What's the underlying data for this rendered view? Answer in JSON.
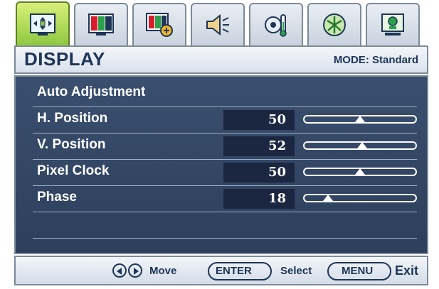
{
  "header": {
    "title": "DISPLAY",
    "mode_label": "MODE: Standard"
  },
  "tabs": [
    {
      "icon": "display-settings-icon",
      "active": true
    },
    {
      "icon": "picture-icon",
      "active": false
    },
    {
      "icon": "picture-advanced-icon",
      "active": false
    },
    {
      "icon": "audio-speaker-icon",
      "active": false
    },
    {
      "icon": "system-settings-icon",
      "active": false
    },
    {
      "icon": "eco-leaf-icon",
      "active": false
    },
    {
      "icon": "save-settings-icon",
      "active": false
    }
  ],
  "menu": {
    "auto_adjustment": "Auto Adjustment",
    "items": [
      {
        "label": "H. Position",
        "value": "50",
        "fraction": 0.5
      },
      {
        "label": "V. Position",
        "value": "52",
        "fraction": 0.52
      },
      {
        "label": "Pixel Clock",
        "value": "50",
        "fraction": 0.5
      },
      {
        "label": "Phase",
        "value": "18",
        "fraction": 0.18
      }
    ]
  },
  "footer": {
    "enter_label": "ENTER",
    "menu_label": "MENU",
    "select_label": "Select",
    "move_label": "Move",
    "exit_label": "Exit"
  },
  "colors": {
    "panel": "#33496a",
    "active_tab": "#8dc63f",
    "header_text": "#1d3556",
    "value_box": "#1b2740"
  }
}
